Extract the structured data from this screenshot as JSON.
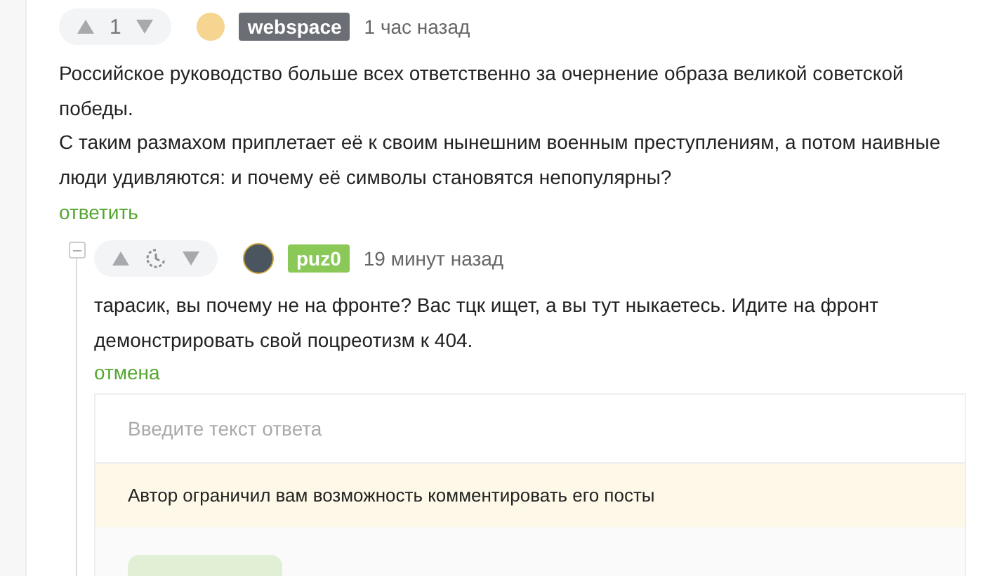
{
  "comment": {
    "vote": {
      "kind": "score",
      "score": "1"
    },
    "author": "webspace",
    "color": "#6b6e75",
    "time": "1 час назад",
    "paragraphs": [
      "Российское руководство больше всех ответственно за очернение образа великой советской победы.",
      "С таким размахом приплетает её к своим нынешним военным преступлениям, а потом наивные люди удивляются: и почему её символы становятся непопулярны?"
    ],
    "action": "ответить",
    "reply": {
      "expanded": true,
      "vote": {
        "kind": "pending"
      },
      "author": "puz0",
      "color": "#8ac858",
      "time": "19 минут назад",
      "paragraphs": [
        "тарасик, вы почему не на фронте? Вас тцк ищет, а вы тут ныкаетесь. Идите на фронт демонстрировать свой поцреотизм к 404."
      ],
      "action": "отмена"
    }
  },
  "reply_form": {
    "placeholder": "Введите текст ответа",
    "notice": "Автор ограничил вам возможность комментировать его посты"
  }
}
